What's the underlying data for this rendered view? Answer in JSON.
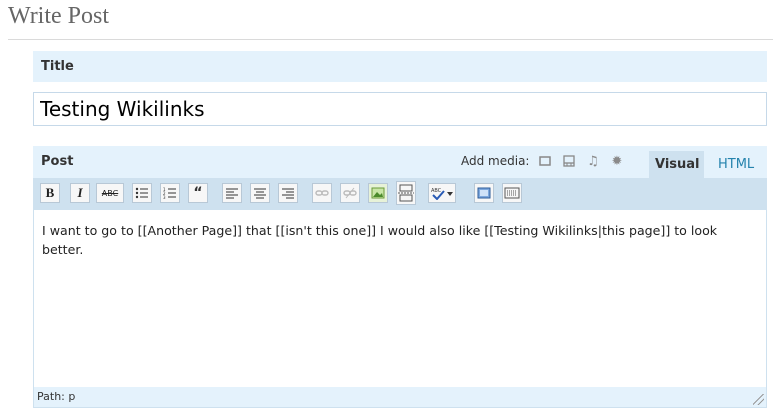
{
  "page": {
    "title": "Write Post"
  },
  "title_box": {
    "label": "Title",
    "value": "Testing Wikilinks"
  },
  "post_box": {
    "label": "Post",
    "add_media_label": "Add media:",
    "tabs": {
      "visual": "Visual",
      "html": "HTML"
    }
  },
  "toolbar": {
    "bold": "B",
    "italic": "I",
    "strike": "ABC"
  },
  "editor": {
    "content": "I want to go to [[Another Page]] that [[isn't this one]] I would also like [[Testing Wikilinks|this page]] to look better.",
    "status_path": "Path: p"
  }
}
